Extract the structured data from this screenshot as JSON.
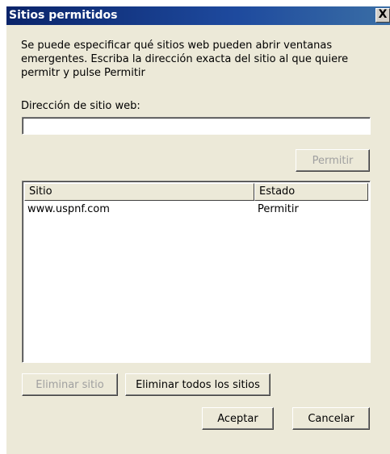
{
  "dialog": {
    "title": "Sitios permitidos",
    "close_glyph": "X",
    "description": "Se puede especificar qué sitios web pueden abrir ventanas emergentes. Escriba la dirección exacta del sitio al que quiere permitr y pulse Permitir",
    "address_label": "Dirección de sitio web:",
    "address_value": "",
    "allow_button": "Permitir",
    "list": {
      "columns": [
        "Sitio",
        "Estado"
      ],
      "rows": [
        {
          "site": "www.uspnf.com",
          "status": "Permitir"
        }
      ]
    },
    "remove_button": "Eliminar sitio",
    "remove_all_button": "Eliminar todos los sitios",
    "ok_button": "Aceptar",
    "cancel_button": "Cancelar"
  }
}
